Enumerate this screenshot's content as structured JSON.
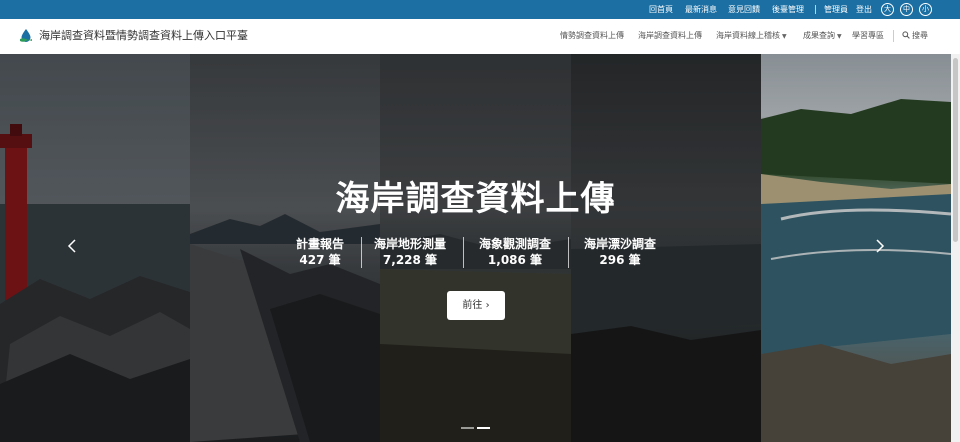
{
  "topbar": {
    "links": [
      "回首頁",
      "最新消息",
      "意見回饋",
      "後臺管理"
    ],
    "admin": "管理員",
    "logout": "登出",
    "font_sizes": [
      "大",
      "中",
      "小"
    ],
    "bg_color": "#1b6fa3"
  },
  "header": {
    "site_title": "海岸調查資料暨情勢調查資料上傳入口平臺",
    "logo_icon": "droplet-logo-icon",
    "nav": [
      "情勢調查資料上傳",
      "海岸調查資料上傳",
      "海岸資料線上稽核",
      "成果查詢",
      "學習專區"
    ],
    "search_label": "搜尋"
  },
  "hero": {
    "title": "海岸調查資料上傳",
    "stats": [
      {
        "label": "計畫報告",
        "value": "427 筆"
      },
      {
        "label": "海岸地形測量",
        "value": "7,228 筆"
      },
      {
        "label": "海象觀測調查",
        "value": "1,086 筆"
      },
      {
        "label": "海岸漂沙調查",
        "value": "296 筆"
      }
    ],
    "go_label": "前往",
    "go_icon": "chevron-right-icon",
    "prev_icon": "chevron-left-icon",
    "next_icon": "chevron-right-icon",
    "slide_count": 2,
    "active_slide": 2
  }
}
